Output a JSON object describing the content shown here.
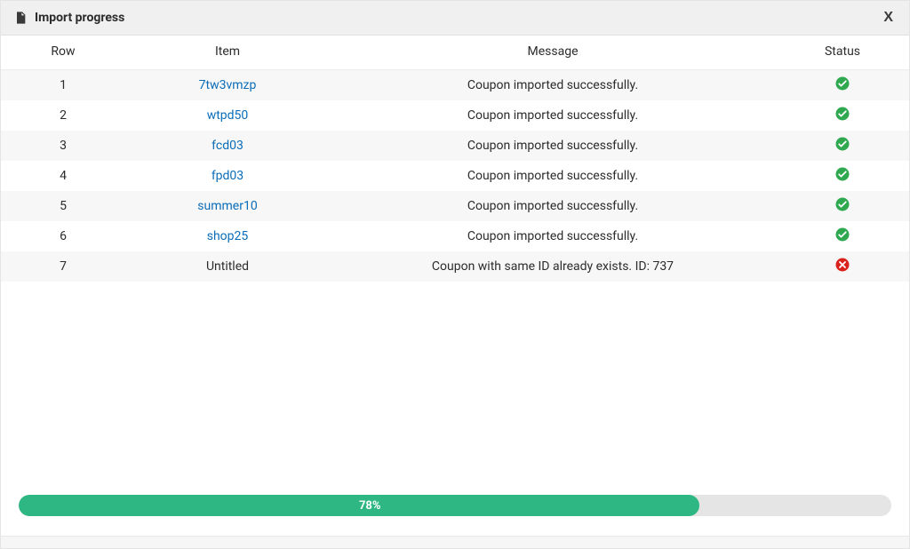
{
  "dialog": {
    "title": "Import progress",
    "close_label": "X"
  },
  "table": {
    "headers": {
      "row": "Row",
      "item": "Item",
      "message": "Message",
      "status": "Status"
    },
    "rows": [
      {
        "row": "1",
        "item": "7tw3vmzp",
        "item_is_link": true,
        "message": "Coupon imported successfully.",
        "status": "success"
      },
      {
        "row": "2",
        "item": "wtpd50",
        "item_is_link": true,
        "message": "Coupon imported successfully.",
        "status": "success"
      },
      {
        "row": "3",
        "item": "fcd03",
        "item_is_link": true,
        "message": "Coupon imported successfully.",
        "status": "success"
      },
      {
        "row": "4",
        "item": "fpd03",
        "item_is_link": true,
        "message": "Coupon imported successfully.",
        "status": "success"
      },
      {
        "row": "5",
        "item": "summer10",
        "item_is_link": true,
        "message": "Coupon imported successfully.",
        "status": "success"
      },
      {
        "row": "6",
        "item": "shop25",
        "item_is_link": true,
        "message": "Coupon imported successfully.",
        "status": "success"
      },
      {
        "row": "7",
        "item": "Untitled",
        "item_is_link": false,
        "message": "Coupon with same ID already exists. ID: 737",
        "status": "error"
      }
    ]
  },
  "progress": {
    "percent": 78,
    "label": "78%"
  },
  "colors": {
    "success": "#2fa84f",
    "error": "#d9221c",
    "progress_fill": "#2fb783",
    "link": "#0b6db7"
  }
}
